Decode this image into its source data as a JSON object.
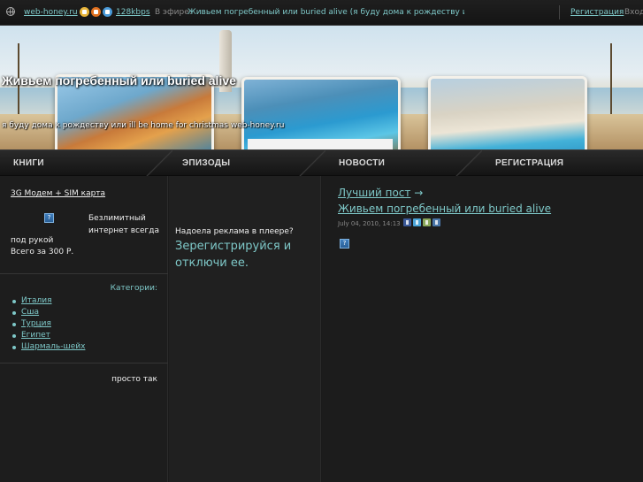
{
  "topbar": {
    "site": "web-honey.ru",
    "bitrate": "128kbps",
    "on_air_label": "В эфире:",
    "track": "Живьем погребенный или buried alive (я буду дома к рождеству или ill be home for christmas)",
    "register": "Регистрация",
    "login": "Вход"
  },
  "banner": {
    "title": "Живьем погребенный или buried alive",
    "subtitle": "я буду дома к рождеству или ill be home for christmas web-honey.ru"
  },
  "nav": {
    "items": [
      {
        "label": "КНИГИ"
      },
      {
        "label": "ЭПИЗОДЫ"
      },
      {
        "label": "НОВОСТИ"
      },
      {
        "label": "РЕГИСТРАЦИЯ"
      }
    ]
  },
  "sidebar": {
    "promo_link": "3G Модем + SIM карта",
    "promo_right": "Безлимитный интернет всегда",
    "promo_under_1": "под рукой",
    "promo_under_2": "Всего за 300 Р.",
    "categories_title": "Категории:",
    "categories": [
      {
        "label": "Италия"
      },
      {
        "label": "Сша"
      },
      {
        "label": "Турция"
      },
      {
        "label": "Египет"
      },
      {
        "label": "Шармаль-шейх"
      }
    ],
    "just_so": "просто так"
  },
  "ad": {
    "question": "Надоела реклама в плеере?",
    "cta": "Зерегистрируйся и отключи ее."
  },
  "post": {
    "best_label": "Лучший пост",
    "arrow": "→",
    "title": "Живьем погребенный или buried alive",
    "date": "July 04, 2010, 14:13"
  },
  "icons": {
    "missing_image": "?"
  }
}
